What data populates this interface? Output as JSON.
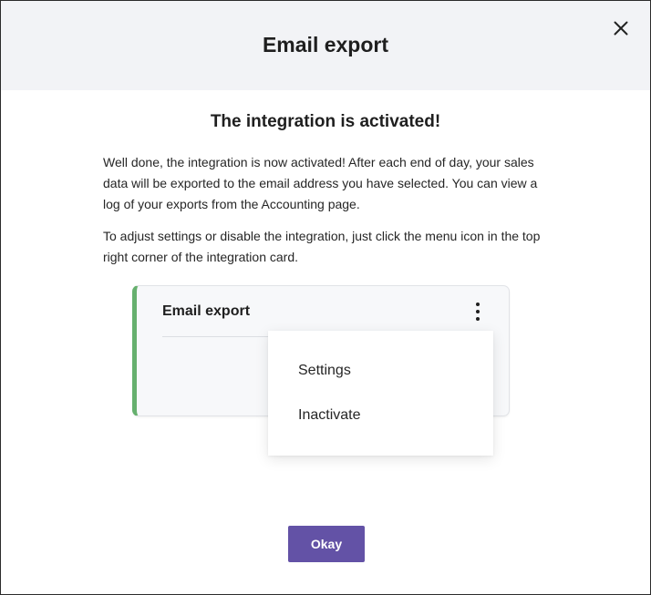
{
  "modal": {
    "title": "Email export",
    "close_icon": "close-icon",
    "heading": "The integration is activated!",
    "paragraph_1": "Well done, the integration is now activated! After each end of day, your sales data will be exported to the email address you have selected. You can view a log of your exports from the Accounting page.",
    "paragraph_2": "To adjust settings or disable the integration, just click the menu icon in the top right corner of the integration card.",
    "okay_label": "Okay"
  },
  "card_preview": {
    "title": "Email export",
    "menu_icon": "kebab-menu-icon",
    "accent_color": "#66b06e"
  },
  "dropdown": {
    "items": [
      {
        "label": "Settings"
      },
      {
        "label": "Inactivate"
      }
    ]
  },
  "colors": {
    "header_bg": "#f2f3f6",
    "primary": "#6352a6",
    "card_accent": "#66b06e"
  }
}
